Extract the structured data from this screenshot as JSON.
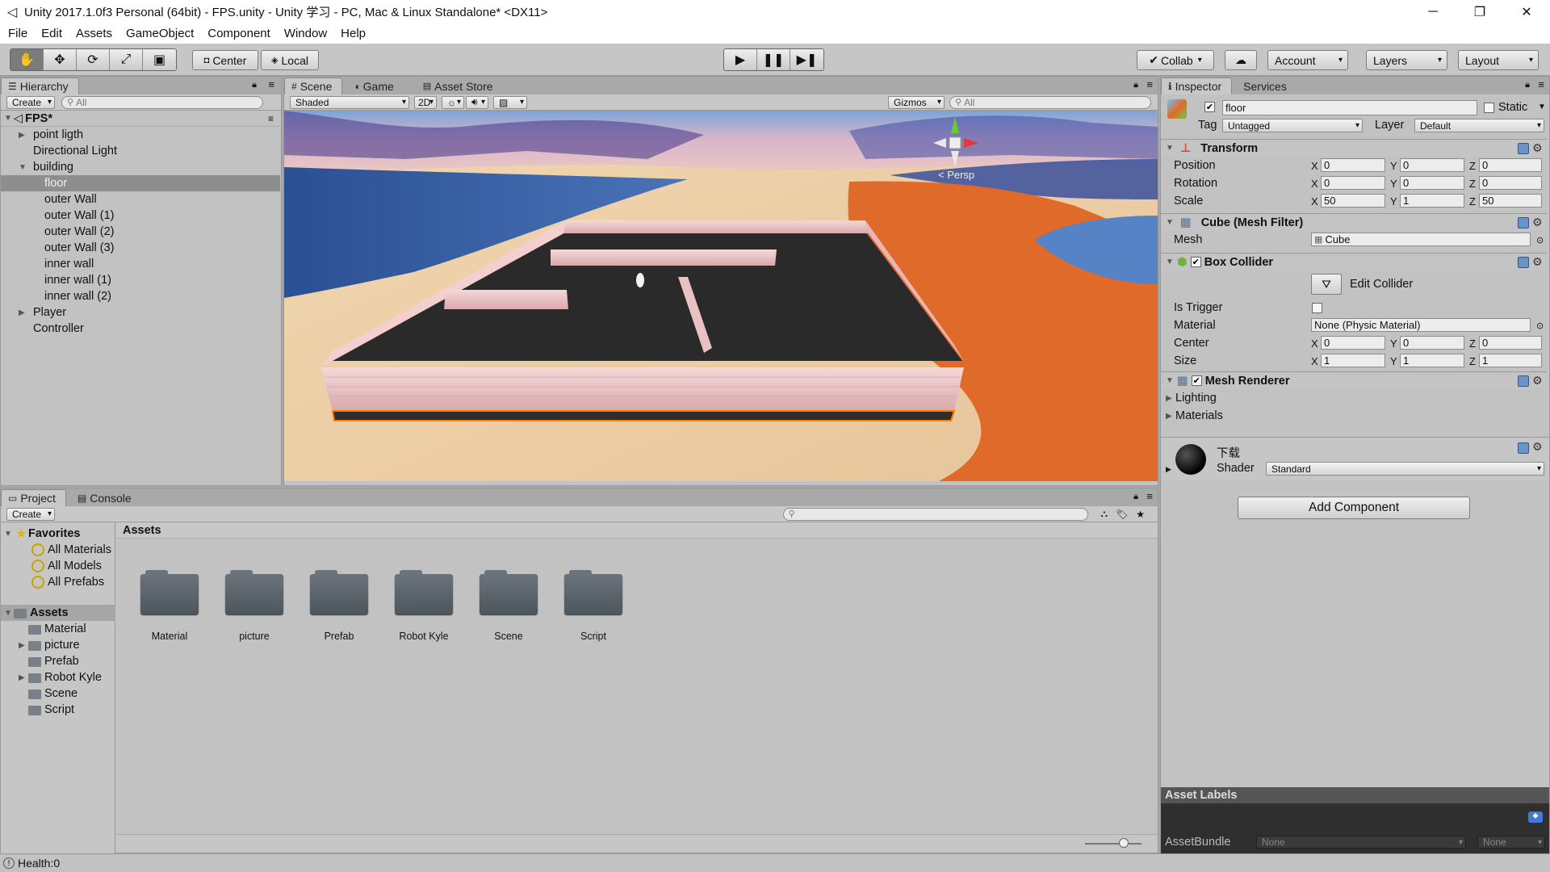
{
  "window": {
    "title": "Unity 2017.1.0f3 Personal (64bit) - FPS.unity - Unity 学习 - PC, Mac & Linux Standalone* <DX11>",
    "controls": {
      "minimize": "─",
      "restore": "❐",
      "close": "✕"
    }
  },
  "menu": [
    "File",
    "Edit",
    "Assets",
    "GameObject",
    "Component",
    "Window",
    "Help"
  ],
  "toolbar": {
    "tools": [
      "hand-icon",
      "move-icon",
      "rotate-icon",
      "scale-icon",
      "rect-icon"
    ],
    "pivot": "Center",
    "space": "Local",
    "collab": "Collab",
    "account": "Account",
    "layers": "Layers",
    "layout": "Layout"
  },
  "hierarchy": {
    "tab": "Hierarchy",
    "create": "Create",
    "search_placeholder": "All",
    "scene_name": "FPS*",
    "items": [
      {
        "label": "point ligth",
        "depth": 1,
        "arrow": "▶"
      },
      {
        "label": "Directional Light",
        "depth": 1,
        "arrow": ""
      },
      {
        "label": "building",
        "depth": 1,
        "arrow": "▼"
      },
      {
        "label": "floor",
        "depth": 2,
        "arrow": "",
        "selected": true
      },
      {
        "label": "outer Wall",
        "depth": 2,
        "arrow": ""
      },
      {
        "label": "outer Wall (1)",
        "depth": 2,
        "arrow": ""
      },
      {
        "label": "outer Wall (2)",
        "depth": 2,
        "arrow": ""
      },
      {
        "label": "outer Wall (3)",
        "depth": 2,
        "arrow": ""
      },
      {
        "label": "inner wall",
        "depth": 2,
        "arrow": ""
      },
      {
        "label": "inner wall (1)",
        "depth": 2,
        "arrow": ""
      },
      {
        "label": "inner wall (2)",
        "depth": 2,
        "arrow": ""
      },
      {
        "label": "Player",
        "depth": 1,
        "arrow": "▶"
      },
      {
        "label": "Controller",
        "depth": 1,
        "arrow": ""
      }
    ]
  },
  "scene": {
    "tabs": [
      "Scene",
      "Game",
      "Asset Store"
    ],
    "shading": "Shaded",
    "mode_2d": "2D",
    "gizmos": "Gizmos",
    "search_placeholder": "All",
    "persp": "< Persp"
  },
  "inspector": {
    "tabs": [
      "Inspector",
      "Services"
    ],
    "object_name": "floor",
    "static_label": "Static",
    "tag_label": "Tag",
    "tag_value": "Untagged",
    "layer_label": "Layer",
    "layer_value": "Default",
    "transform": {
      "title": "Transform",
      "position_label": "Position",
      "position": [
        "0",
        "0",
        "0"
      ],
      "rotation_label": "Rotation",
      "rotation": [
        "0",
        "0",
        "0"
      ],
      "scale_label": "Scale",
      "scale": [
        "50",
        "1",
        "50"
      ]
    },
    "mesh_filter": {
      "title": "Cube (Mesh Filter)",
      "mesh_label": "Mesh",
      "mesh_value": "Cube"
    },
    "box_collider": {
      "title": "Box Collider",
      "edit_collider": "Edit Collider",
      "is_trigger_label": "Is Trigger",
      "material_label": "Material",
      "material_value": "None (Physic Material)",
      "center_label": "Center",
      "center": [
        "0",
        "0",
        "0"
      ],
      "size_label": "Size",
      "size": [
        "1",
        "1",
        "1"
      ]
    },
    "mesh_renderer": {
      "title": "Mesh Renderer",
      "lighting": "Lighting",
      "materials": "Materials"
    },
    "material": {
      "name": "下载",
      "shader_label": "Shader",
      "shader_value": "Standard"
    },
    "add_component": "Add Component",
    "asset_labels": "Asset Labels",
    "asset_bundle_label": "AssetBundle",
    "asset_bundle_value": "None",
    "asset_bundle_variant": "None"
  },
  "project": {
    "tabs": [
      "Project",
      "Console"
    ],
    "create": "Create",
    "favorites_label": "Favorites",
    "favorites": [
      "All Materials",
      "All Models",
      "All Prefabs"
    ],
    "assets_label": "Assets",
    "asset_tree": [
      {
        "label": "Material",
        "arrow": ""
      },
      {
        "label": "picture",
        "arrow": "▶"
      },
      {
        "label": "Prefab",
        "arrow": ""
      },
      {
        "label": "Robot Kyle",
        "arrow": "▶"
      },
      {
        "label": "Scene",
        "arrow": ""
      },
      {
        "label": "Script",
        "arrow": ""
      }
    ],
    "breadcrumb": "Assets",
    "folders": [
      "Material",
      "picture",
      "Prefab",
      "Robot Kyle",
      "Scene",
      "Script"
    ]
  },
  "status": {
    "text": "Health:0"
  }
}
